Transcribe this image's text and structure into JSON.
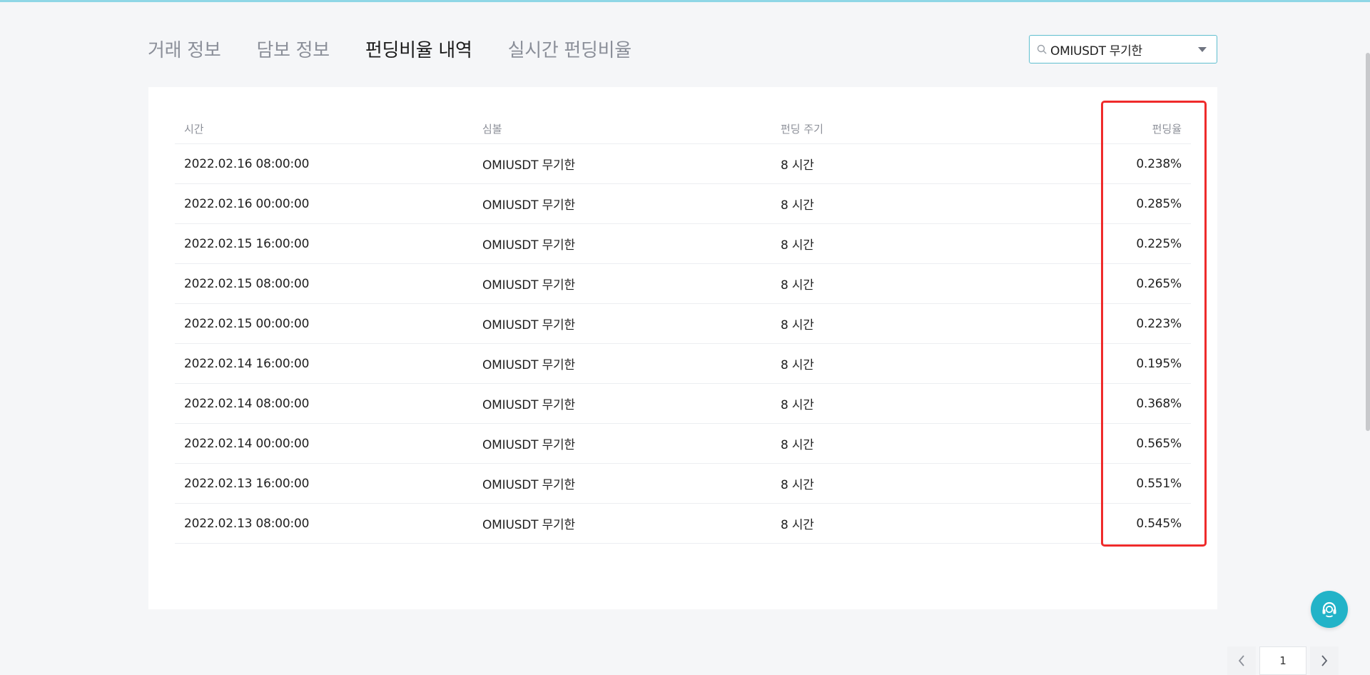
{
  "tabs": [
    {
      "label": "거래 정보",
      "active": false
    },
    {
      "label": "담보 정보",
      "active": false
    },
    {
      "label": "펀딩비율 내역",
      "active": true
    },
    {
      "label": "실시간 펀딩비율",
      "active": false
    }
  ],
  "symbol_select": {
    "value": "OMIUSDT 무기한",
    "icon": "search-icon"
  },
  "table": {
    "headers": [
      "시간",
      "심볼",
      "펀딩 주기",
      "펀딩율"
    ],
    "rows": [
      [
        "2022.02.16 08:00:00",
        "OMIUSDT 무기한",
        "8 시간",
        "0.238%"
      ],
      [
        "2022.02.16 00:00:00",
        "OMIUSDT 무기한",
        "8 시간",
        "0.285%"
      ],
      [
        "2022.02.15 16:00:00",
        "OMIUSDT 무기한",
        "8 시간",
        "0.225%"
      ],
      [
        "2022.02.15 08:00:00",
        "OMIUSDT 무기한",
        "8 시간",
        "0.265%"
      ],
      [
        "2022.02.15 00:00:00",
        "OMIUSDT 무기한",
        "8 시간",
        "0.223%"
      ],
      [
        "2022.02.14 16:00:00",
        "OMIUSDT 무기한",
        "8 시간",
        "0.195%"
      ],
      [
        "2022.02.14 08:00:00",
        "OMIUSDT 무기한",
        "8 시간",
        "0.368%"
      ],
      [
        "2022.02.14 00:00:00",
        "OMIUSDT 무기한",
        "8 시간",
        "0.565%"
      ],
      [
        "2022.02.13 16:00:00",
        "OMIUSDT 무기한",
        "8 시간",
        "0.551%"
      ],
      [
        "2022.02.13 08:00:00",
        "OMIUSDT 무기한",
        "8 시간",
        "0.545%"
      ]
    ]
  },
  "pagination": {
    "current_page": "1"
  },
  "colors": {
    "accent": "#22b3c8",
    "highlight": "#ef2b2b",
    "top_line": "#8fd7e6"
  }
}
